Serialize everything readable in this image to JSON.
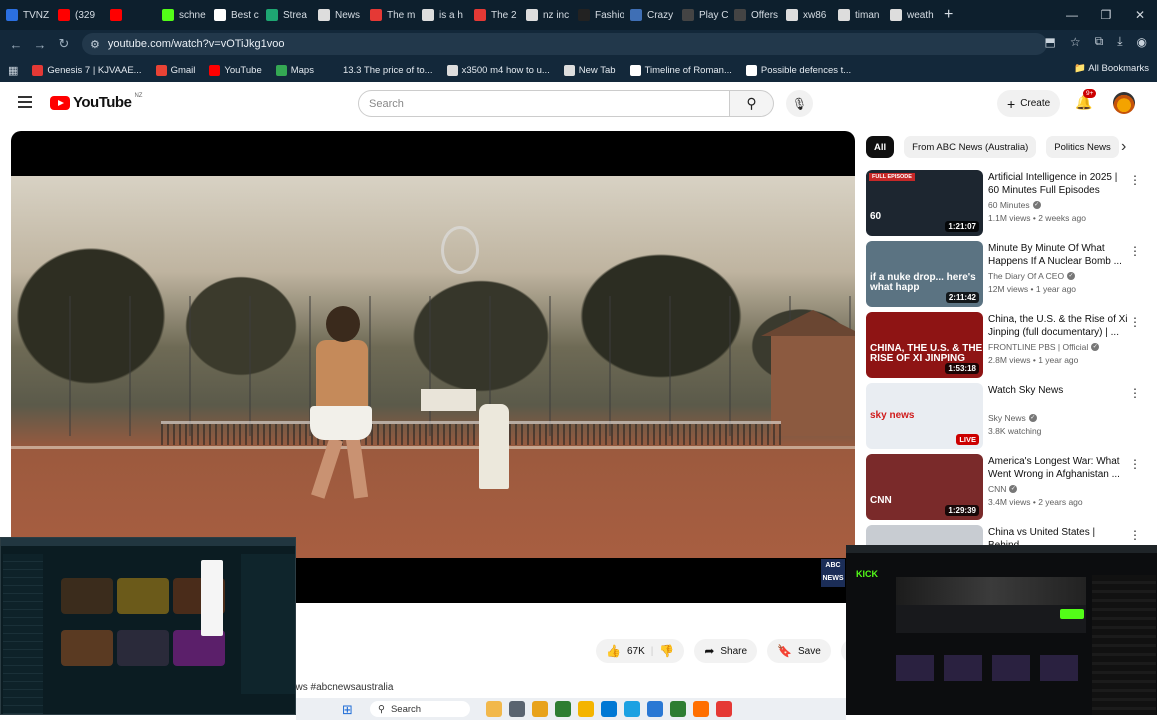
{
  "browser": {
    "tabs": [
      {
        "label": "TVNZ",
        "color": "#2b6fe0"
      },
      {
        "label": "(329",
        "color": "#ff0000"
      },
      {
        "label": "",
        "color": "#ff0000"
      },
      {
        "label": "schne",
        "color": "#53fc18"
      },
      {
        "label": "Best c",
        "color": "#ffffff"
      },
      {
        "label": "Strea",
        "color": "#1ea672"
      },
      {
        "label": "News",
        "color": "#dddddd"
      },
      {
        "label": "The m",
        "color": "#e53935"
      },
      {
        "label": "is a h",
        "color": "#dddddd"
      },
      {
        "label": "The 2",
        "color": "#e53935"
      },
      {
        "label": "nz inc",
        "color": "#dddddd"
      },
      {
        "label": "Fashio",
        "color": "#222222"
      },
      {
        "label": "Crazy",
        "color": "#3f6fb5"
      },
      {
        "label": "Play C",
        "color": "#444444"
      },
      {
        "label": "Offers",
        "color": "#444444"
      },
      {
        "label": "xw86",
        "color": "#dddddd"
      },
      {
        "label": "timan",
        "color": "#dddddd"
      },
      {
        "label": "weath",
        "color": "#dddddd"
      }
    ],
    "url": "youtube.com/watch?v=vOTiJkg1voo",
    "bookmarks": [
      {
        "label": "Genesis 7 | KJVAAE...",
        "color": "#e53935"
      },
      {
        "label": "Gmail",
        "color": "#ea4335"
      },
      {
        "label": "YouTube",
        "color": "#ff0000"
      },
      {
        "label": "Maps",
        "color": "#34a853"
      },
      {
        "label": "13.3 The price of to...",
        "color": "#13283a"
      },
      {
        "label": "x3500 m4 how to u...",
        "color": "#dddddd"
      },
      {
        "label": "New Tab",
        "color": "#dddddd"
      },
      {
        "label": "Timeline of Roman...",
        "color": "#ffffff"
      },
      {
        "label": "Possible defences t...",
        "color": "#ffffff"
      }
    ],
    "all_bookmarks": "All Bookmarks"
  },
  "youtube": {
    "logo": "YouTube",
    "region": "NZ",
    "search_placeholder": "Search",
    "create": "Create",
    "notif_badge": "9+",
    "chips": [
      "All",
      "From ABC News (Australia)",
      "Politics News"
    ],
    "recommendations": [
      {
        "title": "Artificial Intelligence in 2025 | 60 Minutes Full Episodes",
        "channel": "60 Minutes",
        "verified": true,
        "stats": "1.1M views • 2 weeks ago",
        "duration": "1:21:07",
        "thumb_tag": "FULL EPISODE",
        "thumb_caption": "60",
        "thumb_bg": "#1d2630"
      },
      {
        "title": "Minute By Minute Of What Happens If A Nuclear Bomb ...",
        "channel": "The Diary Of A CEO",
        "verified": true,
        "stats": "12M views • 1 year ago",
        "duration": "2:11:42",
        "thumb_tag": "",
        "thumb_caption": "if a nuke drop... here's what happ",
        "thumb_bg": "#5b7382"
      },
      {
        "title": "China, the U.S. & the Rise of Xi Jinping (full documentary) | ...",
        "channel": "FRONTLINE PBS | Official",
        "verified": true,
        "stats": "2.8M views • 1 year ago",
        "duration": "1:53:18",
        "thumb_tag": "",
        "thumb_caption": "CHINA, THE U.S. & THE RISE OF XI JINPING",
        "thumb_bg": "#8e1414"
      },
      {
        "title": "Watch Sky News",
        "channel": "Sky News",
        "verified": true,
        "stats": "3.8K watching",
        "duration": "LIVE",
        "thumb_tag": "",
        "thumb_caption": "sky news",
        "thumb_bg": "#e9edf2"
      },
      {
        "title": "America's Longest War: What Went Wrong in Afghanistan ...",
        "channel": "CNN",
        "verified": true,
        "stats": "3.4M views • 2 years ago",
        "duration": "1:29:39",
        "thumb_tag": "",
        "thumb_caption": "CNN",
        "thumb_bg": "#7a2a2a"
      },
      {
        "title": "China vs United States | Behind",
        "channel": "",
        "verified": false,
        "stats": "",
        "duration": "",
        "thumb_tag": "",
        "thumb_caption": "",
        "thumb_bg": "#c8ccd2"
      }
    ],
    "actions": {
      "likes": "67K",
      "share": "Share",
      "save": "Save"
    },
    "hashtag": "ews #abcnewsaustralia",
    "video_watermark": "ABC NEWS"
  },
  "taskbar": {
    "search": "Search",
    "icons": [
      "#f2b84b",
      "#5a6470",
      "#e8a21a",
      "#2e7d32",
      "#f4b400",
      "#0078d4",
      "#1ba1e2",
      "#2a78d4",
      "#2e7d32",
      "#ff6f00",
      "#e53935"
    ]
  }
}
